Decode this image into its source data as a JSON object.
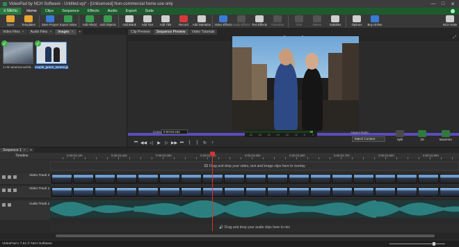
{
  "window": {
    "title": "VideoPad by NCH Software - Untitled.vpj* - [Unlicensed] Non-commercial home use only",
    "controls": [
      "—",
      "□",
      "✕"
    ]
  },
  "menubar": {
    "menu_label": "Menu",
    "tabs": [
      "Home",
      "Clips",
      "Sequence",
      "Effects",
      "Audio",
      "Export",
      "Suite"
    ],
    "active_tab": "Home"
  },
  "toolbar": {
    "buttons": [
      {
        "label": "Open",
        "icon": "open-icon",
        "color": "#e7a531"
      },
      {
        "label": "Templates",
        "icon": "templates-icon",
        "color": "#e7a531"
      },
      {
        "label": "Save Project",
        "icon": "save-icon",
        "color": "#3a7bd5"
      },
      {
        "label": "Export Video",
        "icon": "export-video-icon",
        "color": "#3a9a52"
      },
      {
        "label": "Add File(s)",
        "icon": "add-files-icon",
        "color": "#3a9a52"
      },
      {
        "label": "Add Objects",
        "icon": "add-objects-icon",
        "color": "#3a9a52"
      },
      {
        "label": "Add Blank",
        "icon": "add-blank-icon",
        "color": "#cfcfcf"
      },
      {
        "label": "Add Text",
        "icon": "add-text-icon",
        "color": "#cfcfcf"
      },
      {
        "label": "Add Title",
        "icon": "add-title-icon",
        "color": "#cfcfcf"
      },
      {
        "label": "Record",
        "icon": "record-icon",
        "color": "#d43a3a"
      },
      {
        "label": "Add Narration",
        "icon": "narration-icon",
        "color": "#cfcfcf"
      },
      {
        "label": "Video Effects",
        "icon": "video-effects-icon",
        "color": "#3a7bd5"
      },
      {
        "label": "Audio Effects",
        "icon": "audio-effects-icon",
        "color": "#777"
      },
      {
        "label": "Text Effects",
        "icon": "text-effects-icon",
        "color": "#cfcfcf"
      },
      {
        "label": "Transition",
        "icon": "transition-icon",
        "color": "#777"
      },
      {
        "label": "Trim",
        "icon": "trim-icon",
        "color": "#777"
      },
      {
        "label": "Delete",
        "icon": "delete-icon",
        "color": "#777"
      },
      {
        "label": "Subtitles",
        "icon": "subtitles-icon",
        "color": "#cfcfcf"
      },
      {
        "label": "Options",
        "icon": "options-icon",
        "color": "#cfcfcf"
      },
      {
        "label": "Buy Online",
        "icon": "buy-online-icon",
        "color": "#3a7bd5"
      },
      {
        "label": "NCH Suite",
        "icon": "nch-suite-icon",
        "color": "#cfcfcf"
      }
    ]
  },
  "media_bin": {
    "tabs": [
      {
        "label": "Video Files"
      },
      {
        "label": "Audio Files"
      },
      {
        "label": "Images"
      }
    ],
    "active_tab": "Images",
    "files": [
      {
        "caption": "1-nfc-america-archit..."
      },
      {
        "caption": "couple_green_screen.jp g"
      }
    ]
  },
  "preview": {
    "tabs": [
      "Clip Preview",
      "Sequence Preview",
      "Video Tutorials"
    ],
    "active_tab": "Sequence Preview",
    "title": "Sequence 1",
    "cursor_label": "Cursor:",
    "cursor_value": "0:00:03.432",
    "meter_labels": [
      "-42",
      "-36",
      "-30",
      "-24",
      "-18",
      "-12",
      "-6",
      "0"
    ],
    "aspect_label": "Aspect Ratio:",
    "aspect_value": "Match Content",
    "split_label": "Split",
    "threed_label": "3D",
    "vr_label": "360",
    "maximize_label": "Maximize"
  },
  "timeline": {
    "sequence_tab": "Sequence 1",
    "ruler_name": "Timeline",
    "ruler_labels": [
      "0:00:03.100",
      "0:00:03.200",
      "0:00:03.300",
      "0:00:03.400",
      "0:00:03.500",
      "0:00:03.600",
      "0:00:03.700",
      "0:00:03.800",
      "0:00:03.900"
    ],
    "overlay_msg": "Drag and drop your video, text and image clips here to overlay",
    "tracks": [
      {
        "name": "Video Track 2"
      },
      {
        "name": "Video Track 1"
      }
    ],
    "audio_track": "Audio Track 1",
    "audio_msg": "Drag and drop your audio clips here to mix",
    "playhead_time": "0:00:03.432"
  },
  "status": {
    "text": "VideoPad v 7.51 © NCH Software"
  }
}
